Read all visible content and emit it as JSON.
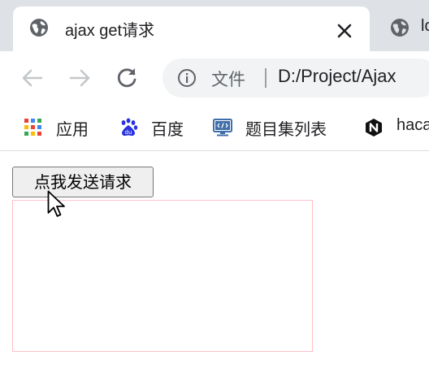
{
  "tabs": [
    {
      "title": "ajax get请求",
      "active": true,
      "icon": "globe-icon"
    },
    {
      "title": "lo",
      "active": false,
      "icon": "globe-icon"
    }
  ],
  "toolbar": {
    "back_icon": "back-arrow-icon",
    "forward_icon": "forward-arrow-icon",
    "reload_icon": "reload-icon"
  },
  "omnibox": {
    "security_label": "文件",
    "url": "D:/Project/Ajax"
  },
  "bookmarks": [
    {
      "label": "应用",
      "icon": "apps-grid-icon"
    },
    {
      "label": "百度",
      "icon": "baidu-paw-icon"
    },
    {
      "label": "题目集列表",
      "icon": "code-monitor-icon"
    },
    {
      "label": "haca",
      "icon": "hexagon-n-icon"
    }
  ],
  "page": {
    "button_label": "点我发送请求",
    "result_text": ""
  },
  "colors": {
    "tab_strip": "#dee1e6",
    "omnibox_bg": "#f1f3f4",
    "result_border": "#ffc0cb",
    "button_bg": "#efefef"
  }
}
